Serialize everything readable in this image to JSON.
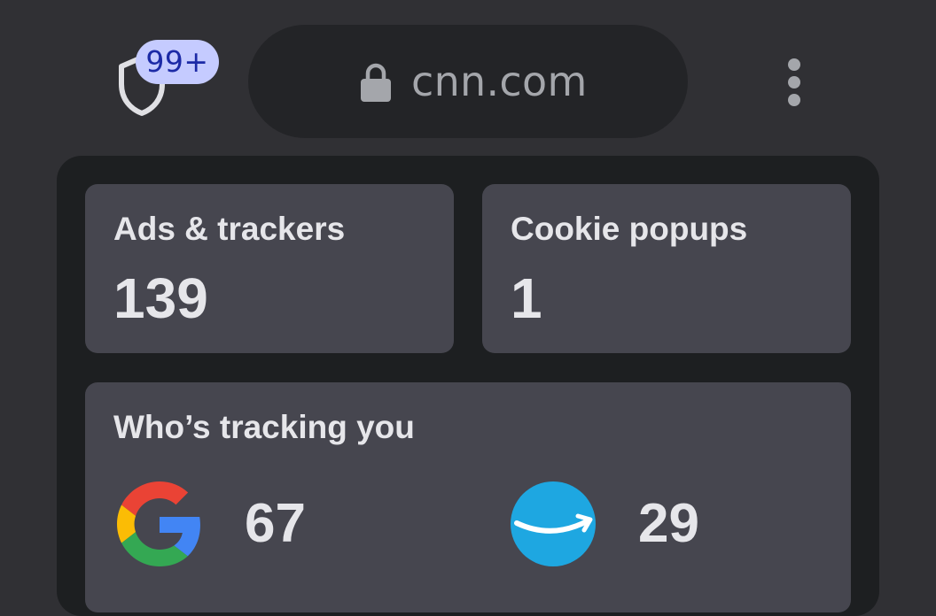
{
  "toolbar": {
    "shield_icon": "shield-icon",
    "badge_count": "99+",
    "lock_icon": "lock-icon",
    "url": "cnn.com",
    "menu_icon": "more-vert-icon"
  },
  "stats": {
    "ads_trackers": {
      "label": "Ads & trackers",
      "value": "139"
    },
    "cookie_popups": {
      "label": "Cookie popups",
      "value": "1"
    }
  },
  "trackers": {
    "title": "Who’s tracking you",
    "items": [
      {
        "name": "Google",
        "icon": "google-logo-icon",
        "count": "67"
      },
      {
        "name": "Amazon",
        "icon": "amazon-logo-icon",
        "count": "29"
      }
    ]
  },
  "colors": {
    "background": "#303034",
    "panel": "#1d1f21",
    "card": "#46464f",
    "badge_bg": "#c5cbff",
    "badge_text": "#1c2aa6",
    "amazon_blue": "#1ea7e1"
  }
}
